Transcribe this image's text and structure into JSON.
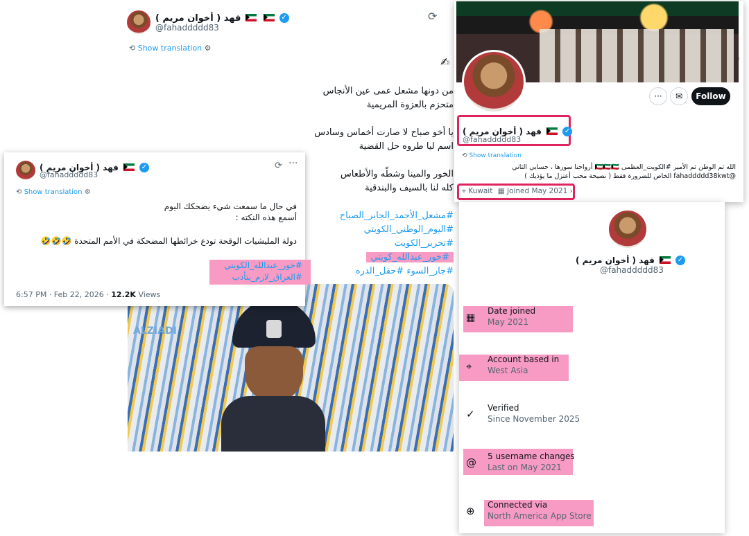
{
  "tweet_main": {
    "display_name": "فهد 🇰🇼 ( أخوان مريم )",
    "name_text": "( أخوان مريم ) فهد",
    "handle": "@fahaddddd83",
    "show_translation": "Show translation",
    "emoji": "✍",
    "lines": [
      "من دونها مشعل عمى عين الأنجاس",
      "متحزم بالعزوة المريمية",
      "",
      "يا أخو صباح لا صارت أخماس وسادس",
      "اسم ليا طروه حل القضية",
      "",
      "الخور والمينا وشطّه والأطعاس",
      "كله لنا بالسيف والبندقية"
    ],
    "hashtags": [
      "#مشعل_الأحمد_الجابر_الصباح",
      "#اليوم_الوطني_الكويتي",
      "#تحرير_الكويت",
      "#خور_عبدالله_كويتي",
      "#جار_السوء #حقل_الدره"
    ]
  },
  "video": {
    "watermark": "ALZIADI"
  },
  "tweet_small": {
    "name_text": "( أخوان مريم ) فهد",
    "handle": "@fahaddddd83",
    "show_translation": "Show translation",
    "line1": "في حال ما سمعت شيء يضحكك اليوم",
    "line2": "أسمع هذه النكته :",
    "line3": "دولة المليشيات الوقحة تودع خرائطها المضحكة في الأمم المتحدة 🤣🤣🤣",
    "hashtag1": "#خور_عبدالله_الكويتي",
    "hashtag2": "#العراق_لازم_يتأدب",
    "time": "6:57 PM · Feb 22, 2026",
    "views_count": "12.2K",
    "views_label": "Views"
  },
  "profile_card": {
    "name_text": "( أخوان مريم ) فهد",
    "handle": "@fahaddddd83",
    "follow_label": "Follow",
    "show_translation": "Show translation",
    "bio_line1": "الله ثم الوطن ثم الأمير #الكويت_العظمى 🇰🇼🇰🇼🇰🇼 أرواحنا سورها ، حسابي الثاني",
    "bio_line2": "@fahaddddd38kwt الخاص للضرورة فقط ( نصيحة محب أعتزل ما يؤذيك )",
    "location": "Kuwait",
    "joined": "Joined May 2021"
  },
  "about_panel": {
    "name_text": "( أخوان مريم ) فهد",
    "handle": "@fahaddddd83",
    "items": [
      {
        "icon": "calendar-icon",
        "title": "Date joined",
        "value": "May 2021"
      },
      {
        "icon": "location-pin-icon",
        "title": "Account based in",
        "value": "West Asia"
      },
      {
        "icon": "verified-check-icon",
        "title": "Verified",
        "value": "Since November 2025"
      },
      {
        "icon": "at-sign-icon",
        "title": "5 username changes",
        "value": "Last on May 2021"
      },
      {
        "icon": "globe-icon",
        "title": "Connected via",
        "value": "North America App Store"
      }
    ]
  },
  "colors": {
    "accent": "#1d9bf0",
    "highlight": "#f79bc4",
    "outline": "#e0245e"
  }
}
